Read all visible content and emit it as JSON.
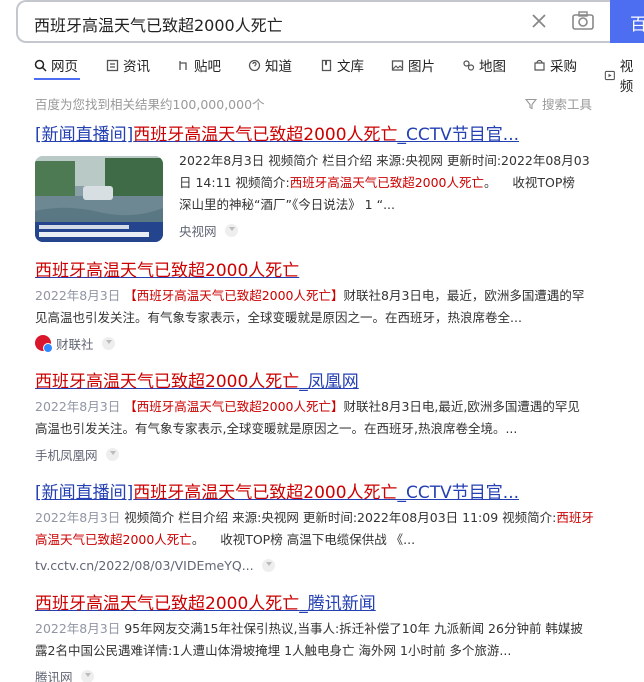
{
  "search": {
    "query": "西班牙高温天气已致超2000人死亡",
    "button_label": "百度一下"
  },
  "tabs": [
    {
      "label": "网页"
    },
    {
      "label": "资讯"
    },
    {
      "label": "贴吧"
    },
    {
      "label": "知道"
    },
    {
      "label": "文库"
    },
    {
      "label": "图片"
    },
    {
      "label": "地图"
    },
    {
      "label": "采购"
    },
    {
      "label": "视频"
    }
  ],
  "result_count": "百度为您找到相关结果约100,000,000个",
  "search_tools": "搜索工具",
  "results": [
    {
      "title_pre": "[新闻直播间]",
      "title_hl": "西班牙高温天气已致超2000人死亡",
      "title_post": "_CCTV节目官...",
      "abstract_line1": "2022年8月3日 视频简介 栏目介绍 来源:央视网 更新时间:2022年08月03",
      "abstract_line2_a": "日 14:11 视频简介:",
      "abstract_line2_hl": "西班牙高温天气已致超2000人死亡",
      "abstract_line2_b": "。    收视TOP榜",
      "abstract_line3": "深山里的神秘“酒厂”《今日说法》 1 “...",
      "source": "央视网"
    },
    {
      "title_hl": "西班牙高温天气已致超2000人死亡",
      "date": "2022年8月3日",
      "hl_box": "【西班牙高温天气已致超2000人死亡】",
      "abstract_a": "财联社8月3日电，最近，欧洲多国遭遇的罕",
      "abstract_line2": "见高温也引发关注。有气象专家表示，全球变暖就是原因之一。在西班牙，热浪席卷全...",
      "source": "财联社"
    },
    {
      "title_hl": "西班牙高温天气已致超2000人死亡",
      "title_post": "_凤凰网",
      "date": "2022年8月3日",
      "hl_box": "【西班牙高温天气已致超2000人死亡】",
      "abstract_a": "财联社8月3日电,最近,欧洲多国遭遇的罕见",
      "abstract_line2": "高温也引发关注。有气象专家表示,全球变暖就是原因之一。在西班牙,热浪席卷全境。...",
      "source": "手机凤凰网"
    },
    {
      "title_pre": "[新闻直播间]",
      "title_hl": "西班牙高温天气已致超2000人死亡",
      "title_post": "_CCTV节目官...",
      "date": "2022年8月3日",
      "abstract_a": "视频简介 栏目介绍 来源:央视网 更新时间:2022年08月03日 11:09 视频简介:",
      "abstract_hl1": "西班牙",
      "abstract_hl2": "高温天气已致超2000人死亡",
      "abstract_b": "。    收视TOP榜 高温下电缆保供战 《...",
      "source": "tv.cctv.cn/2022/08/03/VIDEmeYQ..."
    },
    {
      "title_hl": "西班牙高温天气已致超2000人死亡",
      "title_post": "_腾讯新闻",
      "date": "2022年8月3日",
      "abstract_a": "95年网友交满15年社保引热议,当事人:拆迁补偿了10年 九派新闻 26分钟前 韩媒披",
      "abstract_line2": "露2名中国公民遇难详情:1人遭山体滑坡掩埋 1人触电身亡 海外网 1小时前 多个旅游...",
      "source": "腾讯网"
    }
  ]
}
